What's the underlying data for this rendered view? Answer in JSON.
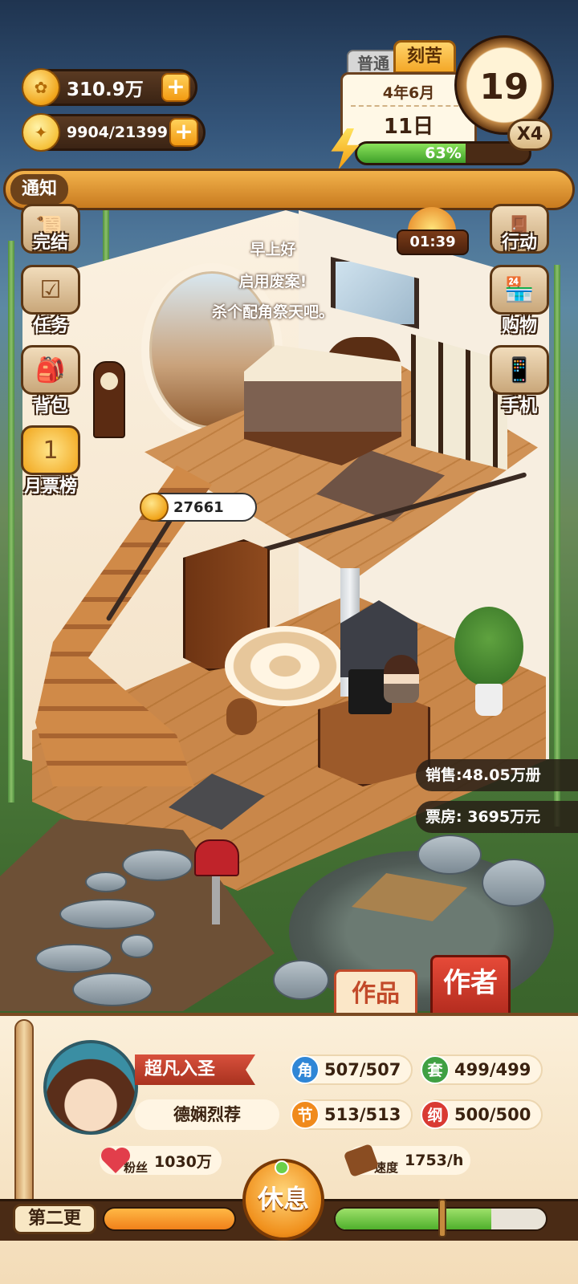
{
  "resources": {
    "gold": "310.9万",
    "inspiration": "9904/21399"
  },
  "calendar": {
    "tab_normal": "普通",
    "tab_hard": "刻苦",
    "month": "4年6月",
    "day": "11日",
    "clock_value": "19",
    "speed": "X4",
    "energy_percent_text": "63%",
    "energy_fraction": 0.63
  },
  "notice": {
    "label": "通知"
  },
  "side_left": [
    {
      "label": "完结",
      "icon": "scroll-icon"
    },
    {
      "label": "任务",
      "icon": "checklist-icon"
    },
    {
      "label": "背包",
      "icon": "backpack-icon"
    },
    {
      "label": "月票榜",
      "icon": "gold-medal-icon"
    }
  ],
  "side_right": [
    {
      "label": "行动",
      "icon": "door-icon"
    },
    {
      "label": "购物",
      "icon": "shop-icon"
    },
    {
      "label": "手机",
      "icon": "phone-icon"
    }
  ],
  "timer": "01:39",
  "greetings": [
    "早上好",
    "启用废案!",
    "杀个配角祭天吧。"
  ],
  "coin_bubble": "27661",
  "stats": {
    "sales": "销售:48.05万册",
    "box_office": "票房: 3695万元"
  },
  "tabs": {
    "works": "作品",
    "author": "作者"
  },
  "profile": {
    "title": "超凡入圣",
    "name": "德娴烈荐",
    "attributes": [
      {
        "badge": "角",
        "value": "507/507",
        "color": "#2f86d6"
      },
      {
        "badge": "套",
        "value": "499/499",
        "color": "#3fa043"
      },
      {
        "badge": "节",
        "value": "513/513",
        "color": "#f08a1c"
      },
      {
        "badge": "纲",
        "value": "500/500",
        "color": "#d93a33"
      }
    ],
    "fans_caption": "粉丝",
    "fans_value": "1030万",
    "speed_caption": "速度",
    "speed_value": "1753/h"
  },
  "rest_button": "休息",
  "chapter": {
    "label": "第二更",
    "progress_left_fraction": 1.0,
    "progress_right_fraction": 0.74
  }
}
